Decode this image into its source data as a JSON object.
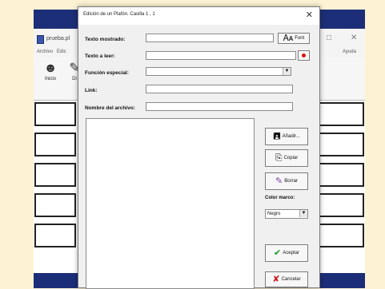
{
  "background_app": {
    "title": "prueba.pl",
    "menu": {
      "file": "Archivo",
      "edit": "Edic",
      "help": "Ayuda"
    },
    "toolbar": {
      "start": "Inicio",
      "second": "Di"
    },
    "window_controls": {
      "maximize": "□",
      "close": "✕"
    }
  },
  "dialog": {
    "title": "Edición de un Plafón. Casilla 1 , 1",
    "close_glyph": "✕",
    "labels": {
      "shown_text": "Texto mostrado:",
      "read_text": "Texto a leer:",
      "special_function": "Función especial:",
      "link": "Link:",
      "file_name": "Nombre del archivo:"
    },
    "fields": {
      "shown_text": "",
      "read_text": "",
      "special_function": "",
      "link": "",
      "file_name": ""
    },
    "buttons": {
      "font": "Font",
      "add": "Añadir...",
      "erase": "Borrar",
      "accept": "Aceptar",
      "cancel": "Cancelar"
    },
    "border_color_label": "Color marco:",
    "border_color_value": "Negro"
  }
}
